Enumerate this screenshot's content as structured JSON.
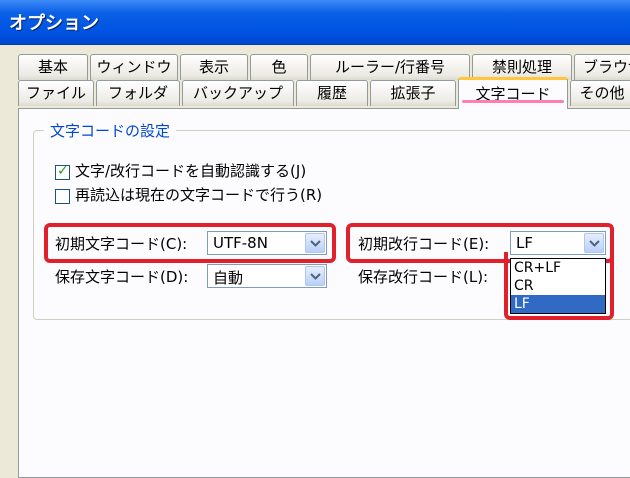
{
  "window": {
    "title": "オプション"
  },
  "tabs_back": [
    {
      "label": "基本"
    },
    {
      "label": "ウィンドウ"
    },
    {
      "label": "表示"
    },
    {
      "label": "色"
    },
    {
      "label": "ルーラー/行番号"
    },
    {
      "label": "禁則処理"
    },
    {
      "label": "ブラウザ"
    }
  ],
  "tabs_front": [
    {
      "label": "ファイル"
    },
    {
      "label": "フォルダ"
    },
    {
      "label": "バックアップ"
    },
    {
      "label": "履歴"
    },
    {
      "label": "拡張子"
    },
    {
      "label": "文字コード"
    },
    {
      "label": "その他"
    }
  ],
  "active_tab": "文字コード",
  "group": {
    "title": "文字コードの設定",
    "auto_detect": {
      "label": "文字/改行コードを自動認識する(J)",
      "checked": true
    },
    "reload": {
      "label": "再読込は現在の文字コードで行う(R)",
      "checked": false
    },
    "initial_charset": {
      "label": "初期文字コード(C):",
      "value": "UTF-8N"
    },
    "save_charset": {
      "label": "保存文字コード(D):",
      "value": "自動"
    },
    "initial_newline": {
      "label": "初期改行コード(E):",
      "value": "LF"
    },
    "save_newline": {
      "label": "保存改行コード(L):"
    }
  },
  "newline_options": [
    "CR+LF",
    "CR",
    "LF"
  ],
  "newline_selected": "LF",
  "colors": {
    "highlight": "#e0202a",
    "selection": "#316ac5",
    "titlebar": "#0054e3"
  }
}
